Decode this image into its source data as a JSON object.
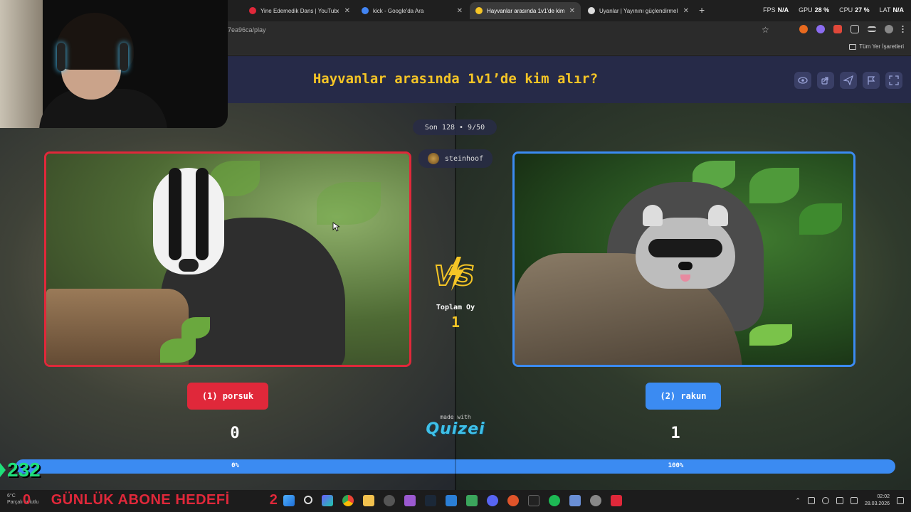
{
  "browser": {
    "tabs": [
      {
        "label": "Yine Edemedik Dans | YouTube",
        "color": "#e0283a"
      },
      {
        "label": "kick - Google'da Ara",
        "color": "#4285f4"
      },
      {
        "label": "Hayvanlar arasında 1v1'de kim",
        "color": "#f5c526"
      },
      {
        "label": "Uyanlar | Yayınını güçlendirmek",
        "color": "#dddddd"
      }
    ],
    "url": "7ea96ca/play",
    "bookmarks_label": "Tüm Yer İşaretleri",
    "stats": {
      "fps_label": "FPS",
      "fps": "N/A",
      "gpu_label": "GPU",
      "gpu": "28 %",
      "cpu_label": "CPU",
      "cpu": "27 %",
      "lat_label": "LAT",
      "lat": "N/A"
    }
  },
  "quiz": {
    "title": "Hayvanlar arasında 1v1’de kim alır?",
    "round": "Son 128 • 9/50",
    "user": "steinhoof",
    "total_label": "Toplam Oy",
    "total_votes": "1",
    "left": {
      "button": "(1) porsuk",
      "score": "0",
      "percent": "0%",
      "percent_value": 0
    },
    "right": {
      "button": "(2) rakun",
      "score": "1",
      "percent": "100%",
      "percent_value": 100
    },
    "made_with": "made with",
    "brand": "Quizei"
  },
  "overlay": {
    "counter": "232",
    "goal_prefix": "0",
    "goal": "GÜNLÜK ABONE HEDEFİ",
    "goal_suffix": "2",
    "weather_temp": "6°C",
    "weather_desc": "Parçalı bulutlu"
  },
  "taskbar": {
    "time": "02:02",
    "date": "28.03.2026",
    "icons": [
      "start-icon",
      "search-icon",
      "copilot-icon",
      "chrome-icon",
      "folder-icon",
      "steam-icon",
      "obs-icon",
      "discord-icon",
      "spotify-icon",
      "settings-icon"
    ]
  },
  "colors": {
    "accent_yellow": "#f5c526",
    "red": "#e0283a",
    "blue": "#3b8bf2",
    "green": "#1fe07a"
  }
}
